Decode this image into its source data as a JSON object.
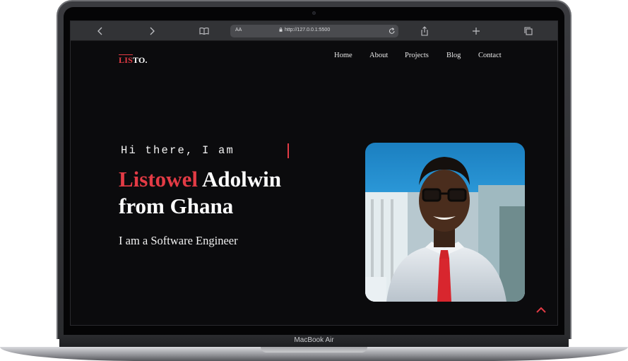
{
  "device": {
    "brand_label": "MacBook Air"
  },
  "browser": {
    "url_text_size": "AA",
    "url": "http://127.0.0.1:5500",
    "icons": [
      "back-icon",
      "forward-icon",
      "bookmarks-icon",
      "lock-icon",
      "reload-icon",
      "share-icon",
      "new-tab-icon",
      "tabs-icon"
    ]
  },
  "site": {
    "logo": {
      "red": "LIS",
      "white": "TO."
    },
    "nav": [
      "Home",
      "About",
      "Projects",
      "Blog",
      "Contact"
    ],
    "hero": {
      "greeting": "Hi there, I am",
      "name_first": "Listowel",
      "name_rest": "Adolwin",
      "name_line2": "from Ghana",
      "role": "I am a Software Engineer"
    },
    "back_to_top_icon": "chevron-up-icon"
  },
  "colors": {
    "accent": "#e33b45",
    "background": "#0b0b0d",
    "text": "#ffffff"
  }
}
